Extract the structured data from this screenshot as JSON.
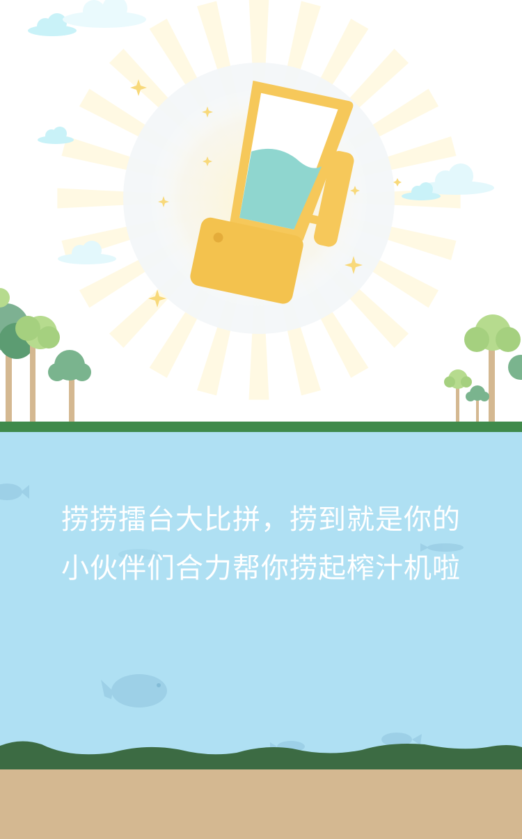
{
  "headline": {
    "line1": "捞捞擂台大比拼，捞到就是你的",
    "line2": "小伙伴们合力帮你捞起榨汁机啦"
  },
  "colors": {
    "sky": "#ffffff",
    "water": "#afe0f3",
    "grass": "#3f8a4b",
    "sand": "#d4b891",
    "blender": "#f6c85a",
    "juice": "#8fd6cf",
    "cloud": "#c9f2f8"
  },
  "icons": {
    "prize": "blender-icon",
    "sparkle": "sparkle-icon",
    "cloud": "cloud-icon",
    "tree": "tree-icon",
    "fish": "fish-icon"
  }
}
